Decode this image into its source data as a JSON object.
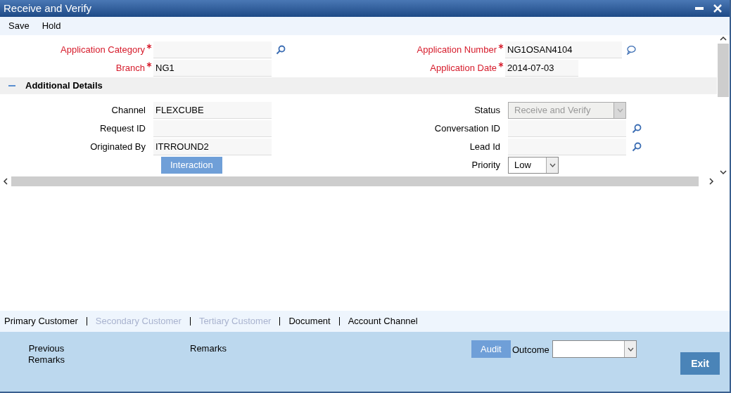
{
  "window": {
    "title": "Receive and Verify"
  },
  "menu": [
    "Save",
    "Hold"
  ],
  "header_fields": {
    "left": [
      {
        "label": "Application Category",
        "required": true,
        "search_button": true,
        "comment_button": false
      },
      {
        "label": "Branch",
        "required": true,
        "value": "NG1",
        "search_button": false,
        "comment_button": false
      }
    ],
    "right": [
      {
        "label": "Application Number",
        "required": true,
        "value": "NG1OSAN4104",
        "search_button": false,
        "comment_button": true
      },
      {
        "label": "Application Date",
        "required": true,
        "value": "2014-07-03",
        "search_button": false,
        "comment_button": false
      }
    ]
  },
  "section": {
    "title": "Additional Details",
    "expanded": true,
    "left": [
      {
        "kind": "text",
        "label": "Channel",
        "value": "FLEXCUBE"
      },
      {
        "kind": "text",
        "label": "Request ID"
      },
      {
        "kind": "text",
        "label": "Originated By",
        "value": "ITRROUND2"
      },
      {
        "kind": "button",
        "label": "Interaction"
      }
    ],
    "right": [
      {
        "kind": "select",
        "label": "Status",
        "value": "Receive and Verify",
        "disabled": true,
        "search_button": false
      },
      {
        "kind": "text",
        "label": "Conversation ID",
        "search_button": true
      },
      {
        "kind": "text",
        "label": "Lead Id",
        "search_button": true
      },
      {
        "kind": "select",
        "label": "Priority",
        "value": "Low",
        "disabled": false,
        "search_button": false
      }
    ]
  },
  "tabs": [
    {
      "label": "Primary Customer",
      "disabled": false
    },
    {
      "label": "Secondary Customer",
      "disabled": true
    },
    {
      "label": "Tertiary Customer",
      "disabled": true
    },
    {
      "label": "Document",
      "disabled": false
    },
    {
      "label": "Account Channel",
      "disabled": false
    }
  ],
  "footer": {
    "previous_remarks": "Previous Remarks",
    "remarks": "Remarks",
    "audit": "Audit",
    "outcome_label": "Outcome",
    "exit": "Exit"
  }
}
